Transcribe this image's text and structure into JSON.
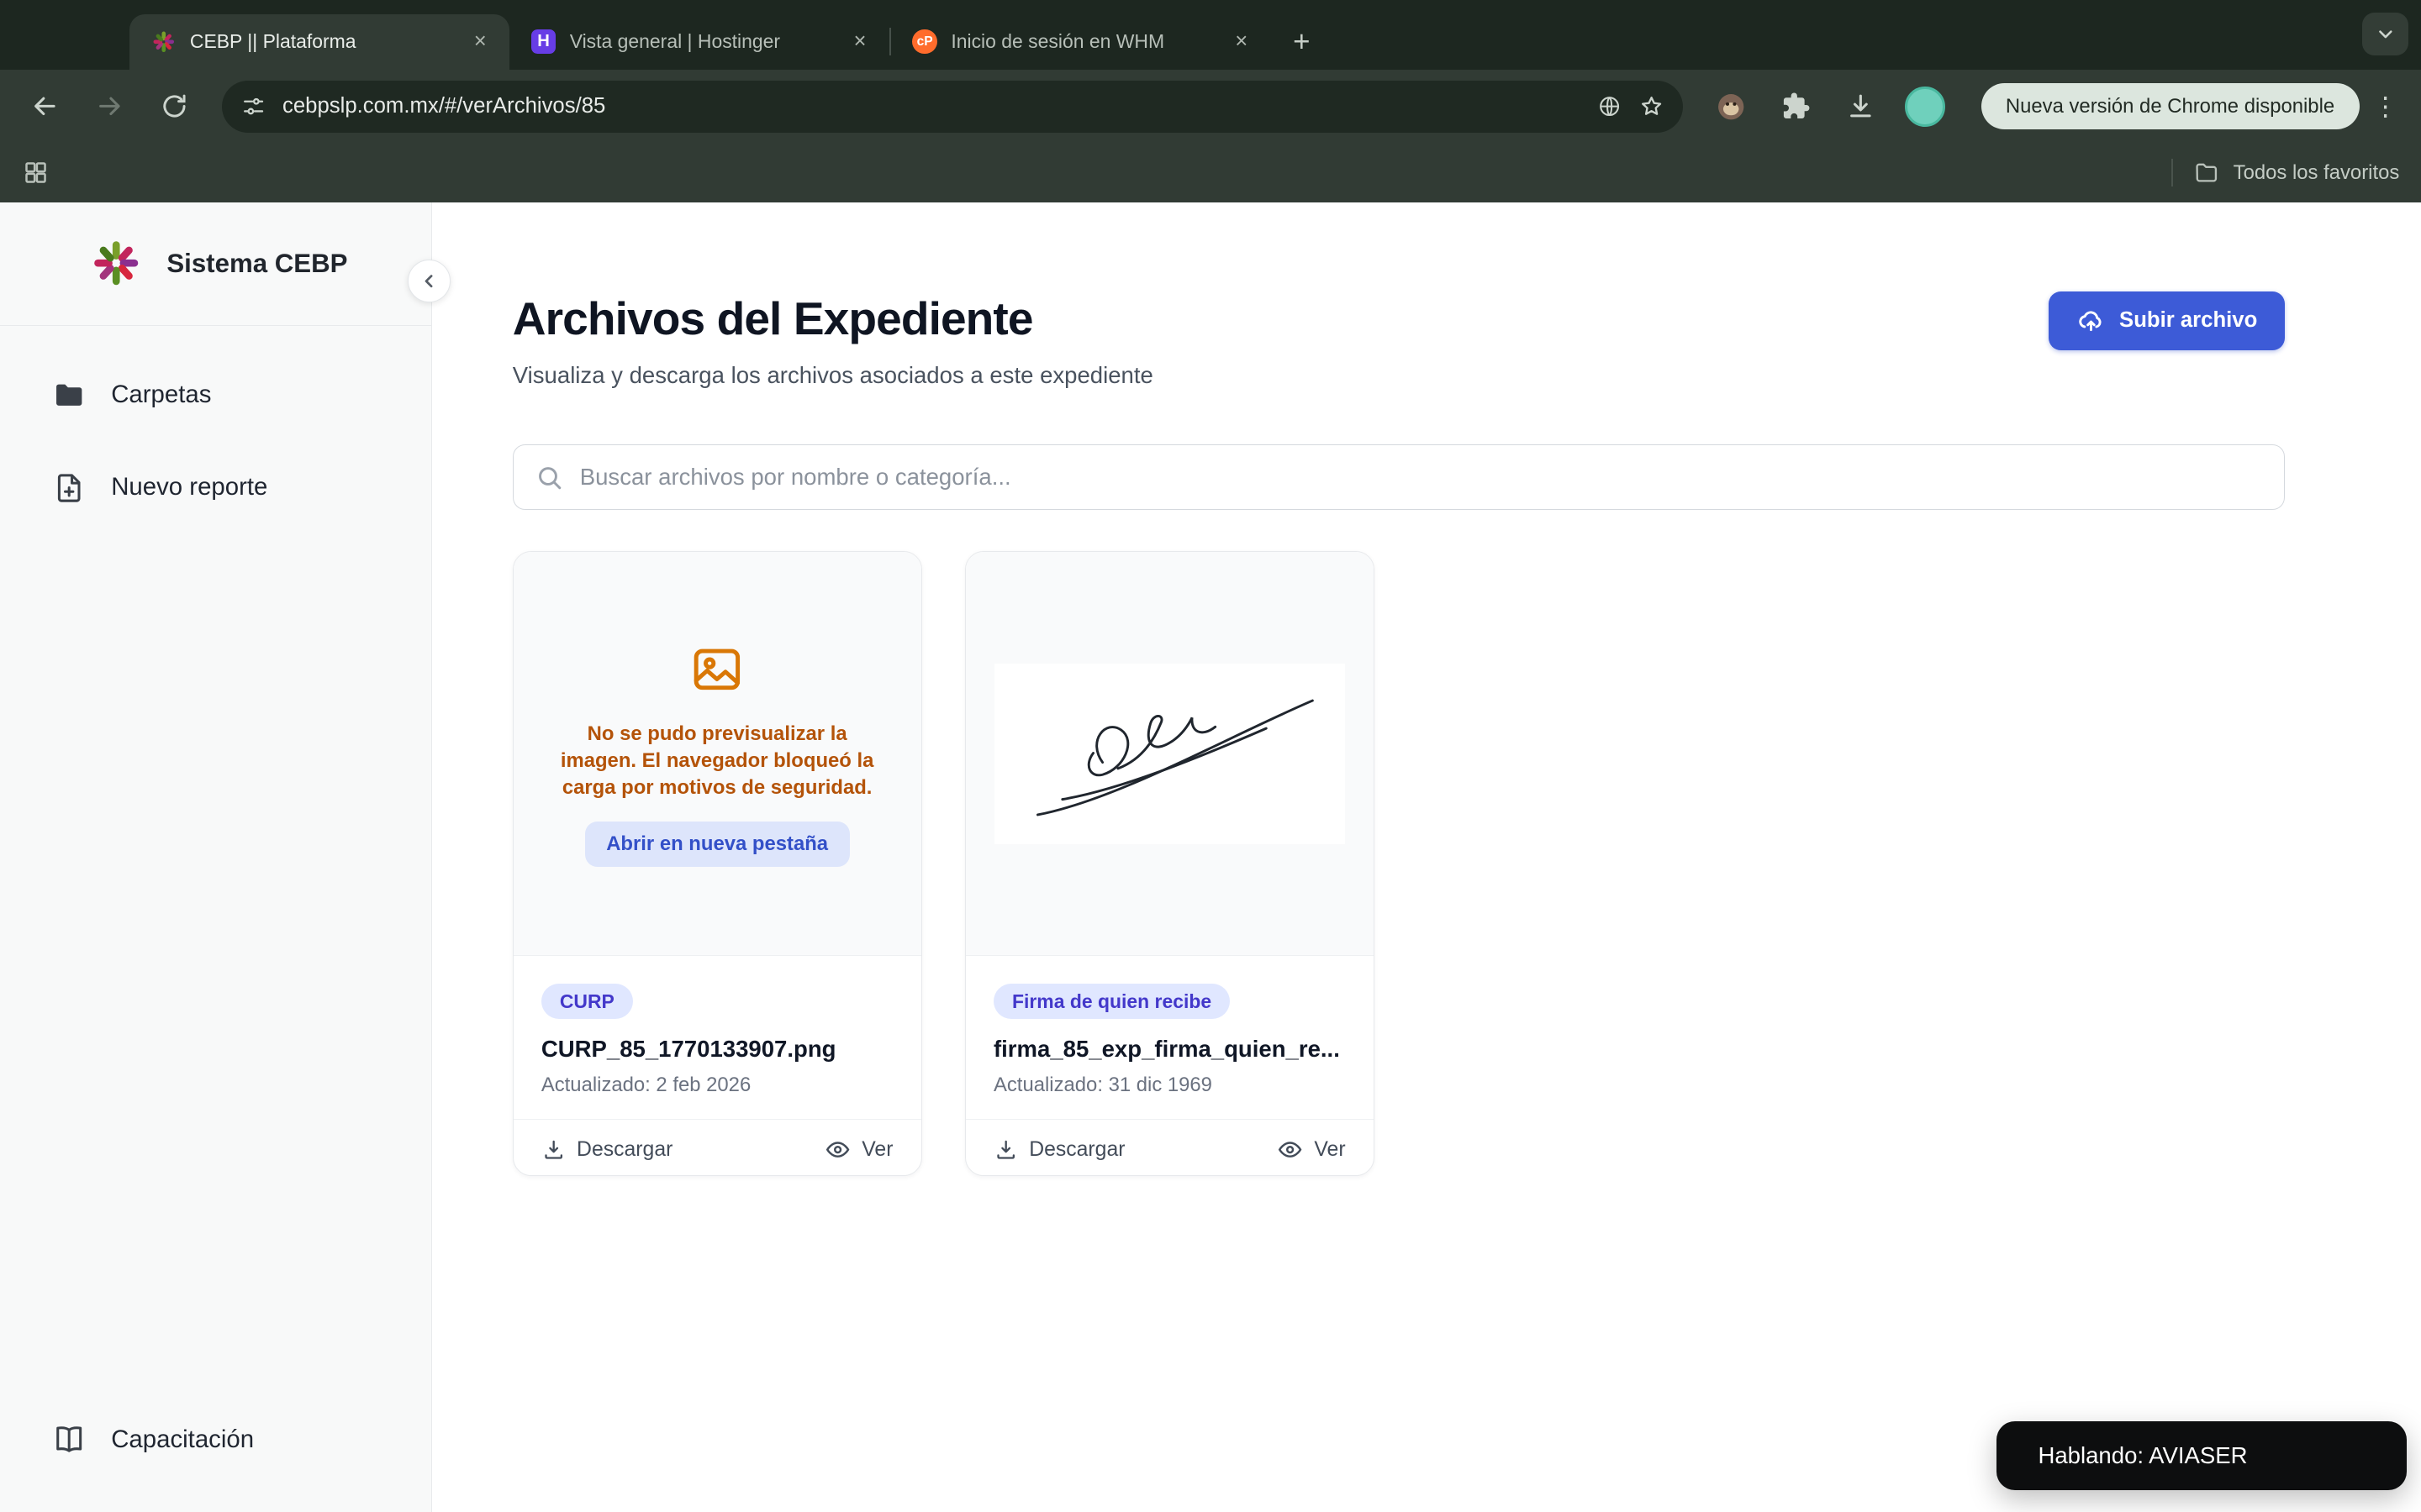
{
  "browser": {
    "tabs": [
      {
        "title": "CEBP || Plataforma"
      },
      {
        "title": "Vista general | Hostinger"
      },
      {
        "title": "Inicio de sesión en WHM"
      }
    ],
    "url": "cebpslp.com.mx/#/verArchivos/85",
    "update_button": "Nueva versión de Chrome disponible",
    "bookmarks": {
      "all_favorites": "Todos los favoritos"
    }
  },
  "sidebar": {
    "brand": "Sistema CEBP",
    "items": [
      {
        "label": "Carpetas"
      },
      {
        "label": "Nuevo reporte"
      }
    ],
    "bottom_item": {
      "label": "Capacitación"
    }
  },
  "main": {
    "title": "Archivos del Expediente",
    "subtitle": "Visualiza y descarga los archivos asociados a este expediente",
    "upload_button": "Subir archivo",
    "search_placeholder": "Buscar archivos por nombre o categoría...",
    "cards": [
      {
        "badge": "CURP",
        "filename": "CURP_85_1770133907.png",
        "updated": "Actualizado: 2 feb 2026",
        "preview_error_text": "No se pudo previsualizar la imagen. El navegador bloqueó la carga por motivos de seguridad.",
        "open_new_tab_button": "Abrir en nueva pestaña",
        "download_label": "Descargar",
        "view_label": "Ver"
      },
      {
        "badge": "Firma de quien recibe",
        "filename": "firma_85_exp_firma_quien_re...",
        "updated": "Actualizado: 31 dic 1969",
        "download_label": "Descargar",
        "view_label": "Ver"
      }
    ],
    "toast": "Hablando: AVIASER"
  },
  "colors": {
    "accent_blue": "#3d5bd7",
    "badge_bg": "#e0e7ff",
    "badge_text": "#4338ca",
    "warning_text": "#b45309",
    "warning_icon": "#d97706",
    "toast_bg": "#0d0e0f"
  }
}
